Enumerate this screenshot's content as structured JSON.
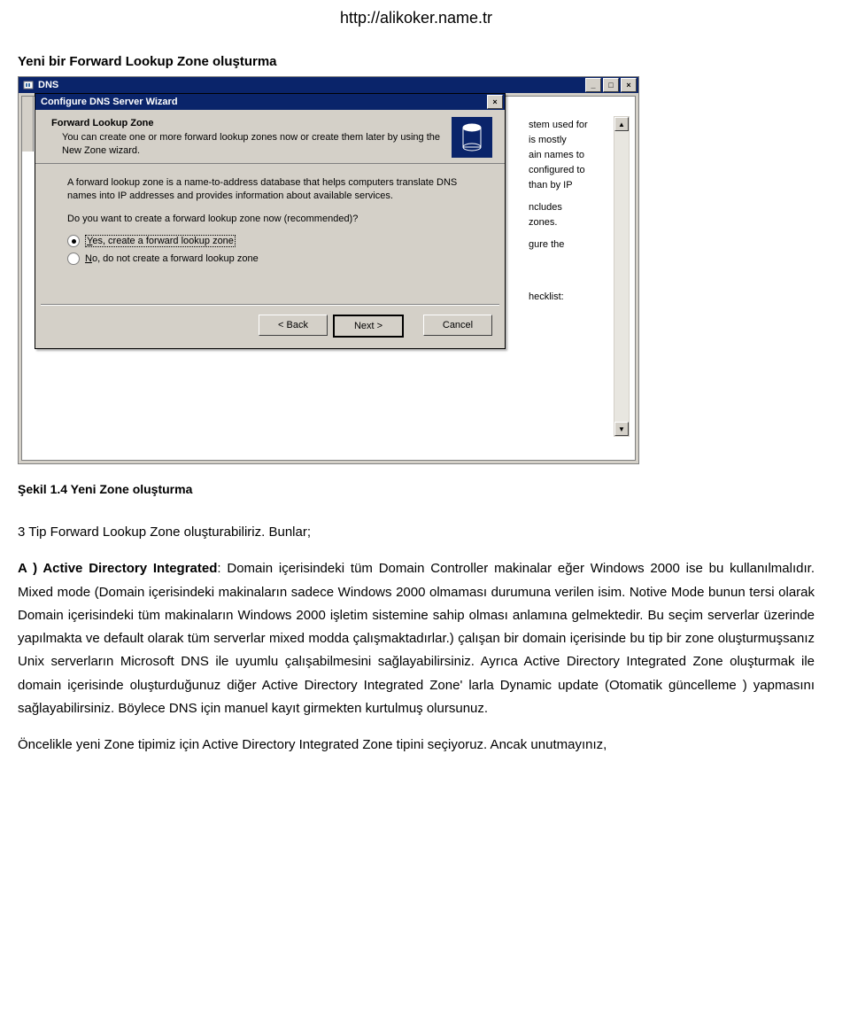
{
  "header_url": "http://alikoker.name.tr",
  "section_title": "Yeni bir Forward Lookup Zone oluşturma",
  "mmc": {
    "title": "DNS",
    "inner_title": ""
  },
  "dialog": {
    "title": "Configure DNS Server Wizard",
    "header_title": "Forward Lookup Zone",
    "header_sub": "You can create one or more forward lookup zones now or create them later by using the New Zone wizard.",
    "body_p1": "A forward lookup zone is a name-to-address database that helps computers translate DNS names into IP addresses and provides information about available services.",
    "body_p2": "Do you want to create a forward lookup zone now (recommended)?",
    "radio_yes_prefix": "Y",
    "radio_yes_rest": "es, create a forward lookup zone",
    "radio_no_prefix": "N",
    "radio_no_rest": "o, do not create a forward lookup zone",
    "btn_back": "< Back",
    "btn_next": "Next >",
    "btn_cancel": "Cancel"
  },
  "underlay": {
    "l1": "stem used for",
    "l2": "is mostly",
    "l3": "ain names to",
    "l4": "configured to",
    "l5": "than by IP",
    "l6": "ncludes",
    "l7": "zones.",
    "l8": "gure the",
    "l9": "hecklist:"
  },
  "caption": "Şekil 1.4 Yeni Zone oluşturma",
  "body": {
    "p1": "3 Tip Forward Lookup Zone oluşturabiliriz. Bunlar;",
    "p2a": "A ) Active Directory Integrated",
    "p2b": ": Domain içerisindeki tüm Domain Controller makinalar eğer Windows 2000 ise bu kullanılmalıdır. Mixed mode (Domain içerisindeki makinaların sadece Windows 2000 olmaması durumuna verilen isim. Notive Mode bunun tersi olarak Domain içerisindeki tüm makinaların Windows 2000 işletim sistemine sahip olması anlamına gelmektedir. Bu seçim serverlar üzerinde yapılmakta ve default olarak tüm serverlar mixed modda çalışmaktadırlar.) çalışan bir domain içerisinde bu tip bir zone oluşturmuşsanız Unix serverların Microsoft DNS ile uyumlu çalışabilmesini sağlayabilirsiniz. Ayrıca Active Directory Integrated Zone oluşturmak ile domain içerisinde oluşturduğunuz diğer Active Directory Integrated Zone' larla Dynamic update (Otomatik güncelleme ) yapmasını sağlayabilirsiniz. Böylece DNS için manuel kayıt girmekten kurtulmuş olursunuz.",
    "p3": "Öncelikle yeni Zone tipimiz için Active Directory Integrated Zone tipini seçiyoruz. Ancak unutmayınız,"
  }
}
